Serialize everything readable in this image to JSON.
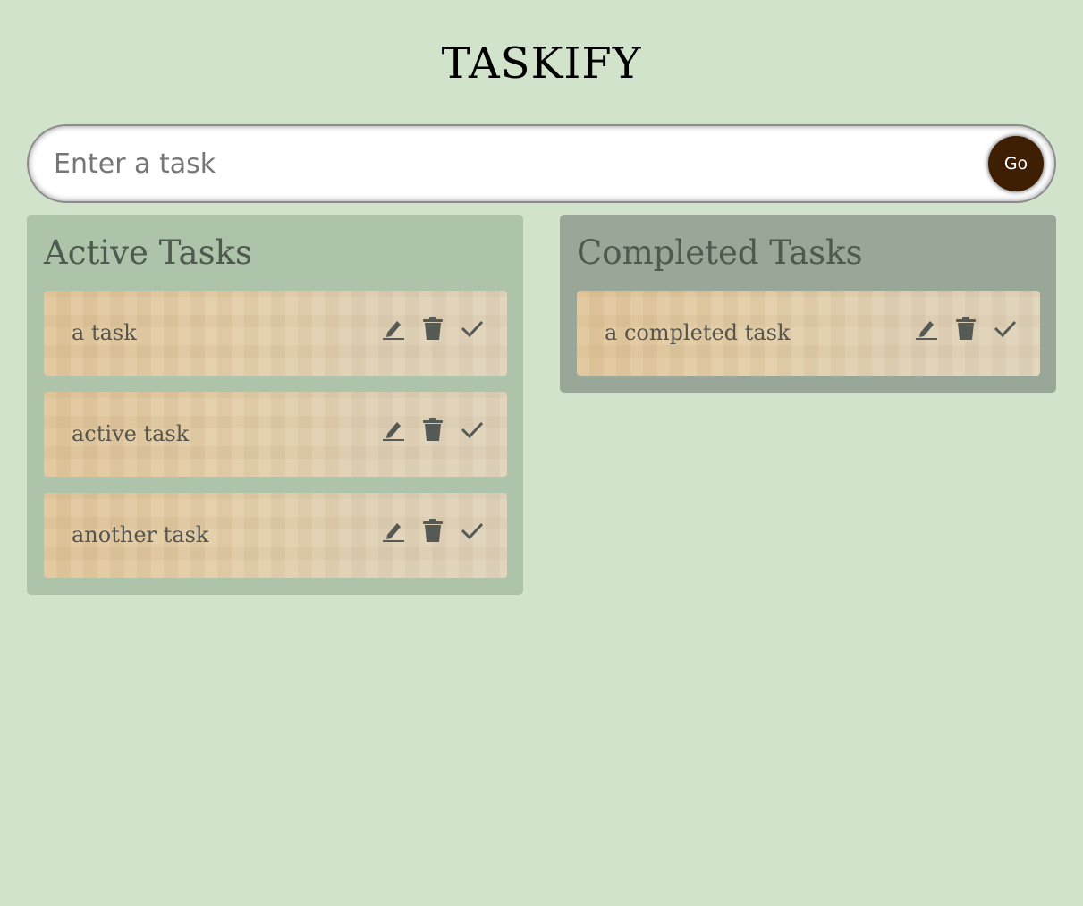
{
  "app": {
    "title": "TASKIFY"
  },
  "input": {
    "placeholder": "Enter a task",
    "value": "",
    "submit_label": "Go"
  },
  "active": {
    "title": "Active Tasks",
    "tasks": [
      {
        "text": "a task"
      },
      {
        "text": "active task"
      },
      {
        "text": "another task"
      }
    ]
  },
  "completed": {
    "title": "Completed Tasks",
    "tasks": [
      {
        "text": "a completed task"
      }
    ]
  },
  "icons": {
    "edit": "pencil-icon",
    "delete": "trash-icon",
    "done": "checkmark-icon"
  },
  "colors": {
    "background": "#d2e3cc",
    "active_panel": "#adc3aa",
    "completed_panel": "#98a797",
    "go_button": "#3e1f04",
    "icon": "#555a55"
  }
}
